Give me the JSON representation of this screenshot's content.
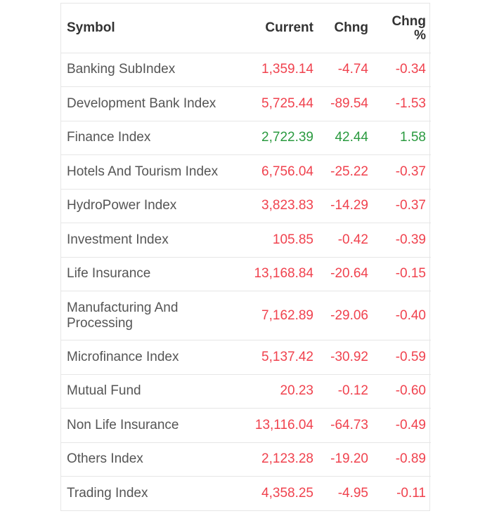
{
  "table": {
    "headers": {
      "symbol": "Symbol",
      "current": "Current",
      "change": "Chng",
      "change_pct_line1": "Chng",
      "change_pct_line2": "%"
    },
    "colors": {
      "negative": "#f0424e",
      "positive": "#2a9a3f"
    },
    "rows": [
      {
        "symbol": "Banking SubIndex",
        "current": "1,359.14",
        "change": "-4.74",
        "change_pct": "-0.34",
        "direction": "neg"
      },
      {
        "symbol": "Development Bank Index",
        "current": "5,725.44",
        "change": "-89.54",
        "change_pct": "-1.53",
        "direction": "neg"
      },
      {
        "symbol": "Finance Index",
        "current": "2,722.39",
        "change": "42.44",
        "change_pct": "1.58",
        "direction": "pos"
      },
      {
        "symbol": "Hotels And Tourism Index",
        "current": "6,756.04",
        "change": "-25.22",
        "change_pct": "-0.37",
        "direction": "neg"
      },
      {
        "symbol": "HydroPower Index",
        "current": "3,823.83",
        "change": "-14.29",
        "change_pct": "-0.37",
        "direction": "neg"
      },
      {
        "symbol": "Investment Index",
        "current": "105.85",
        "change": "-0.42",
        "change_pct": "-0.39",
        "direction": "neg"
      },
      {
        "symbol": "Life Insurance",
        "current": "13,168.84",
        "change": "-20.64",
        "change_pct": "-0.15",
        "direction": "neg"
      },
      {
        "symbol": "Manufacturing And Processing",
        "current": "7,162.89",
        "change": "-29.06",
        "change_pct": "-0.40",
        "direction": "neg"
      },
      {
        "symbol": "Microfinance Index",
        "current": "5,137.42",
        "change": "-30.92",
        "change_pct": "-0.59",
        "direction": "neg"
      },
      {
        "symbol": "Mutual Fund",
        "current": "20.23",
        "change": "-0.12",
        "change_pct": "-0.60",
        "direction": "neg"
      },
      {
        "symbol": "Non Life Insurance",
        "current": "13,116.04",
        "change": "-64.73",
        "change_pct": "-0.49",
        "direction": "neg"
      },
      {
        "symbol": "Others Index",
        "current": "2,123.28",
        "change": "-19.20",
        "change_pct": "-0.89",
        "direction": "neg"
      },
      {
        "symbol": "Trading Index",
        "current": "4,358.25",
        "change": "-4.95",
        "change_pct": "-0.11",
        "direction": "neg"
      }
    ]
  }
}
